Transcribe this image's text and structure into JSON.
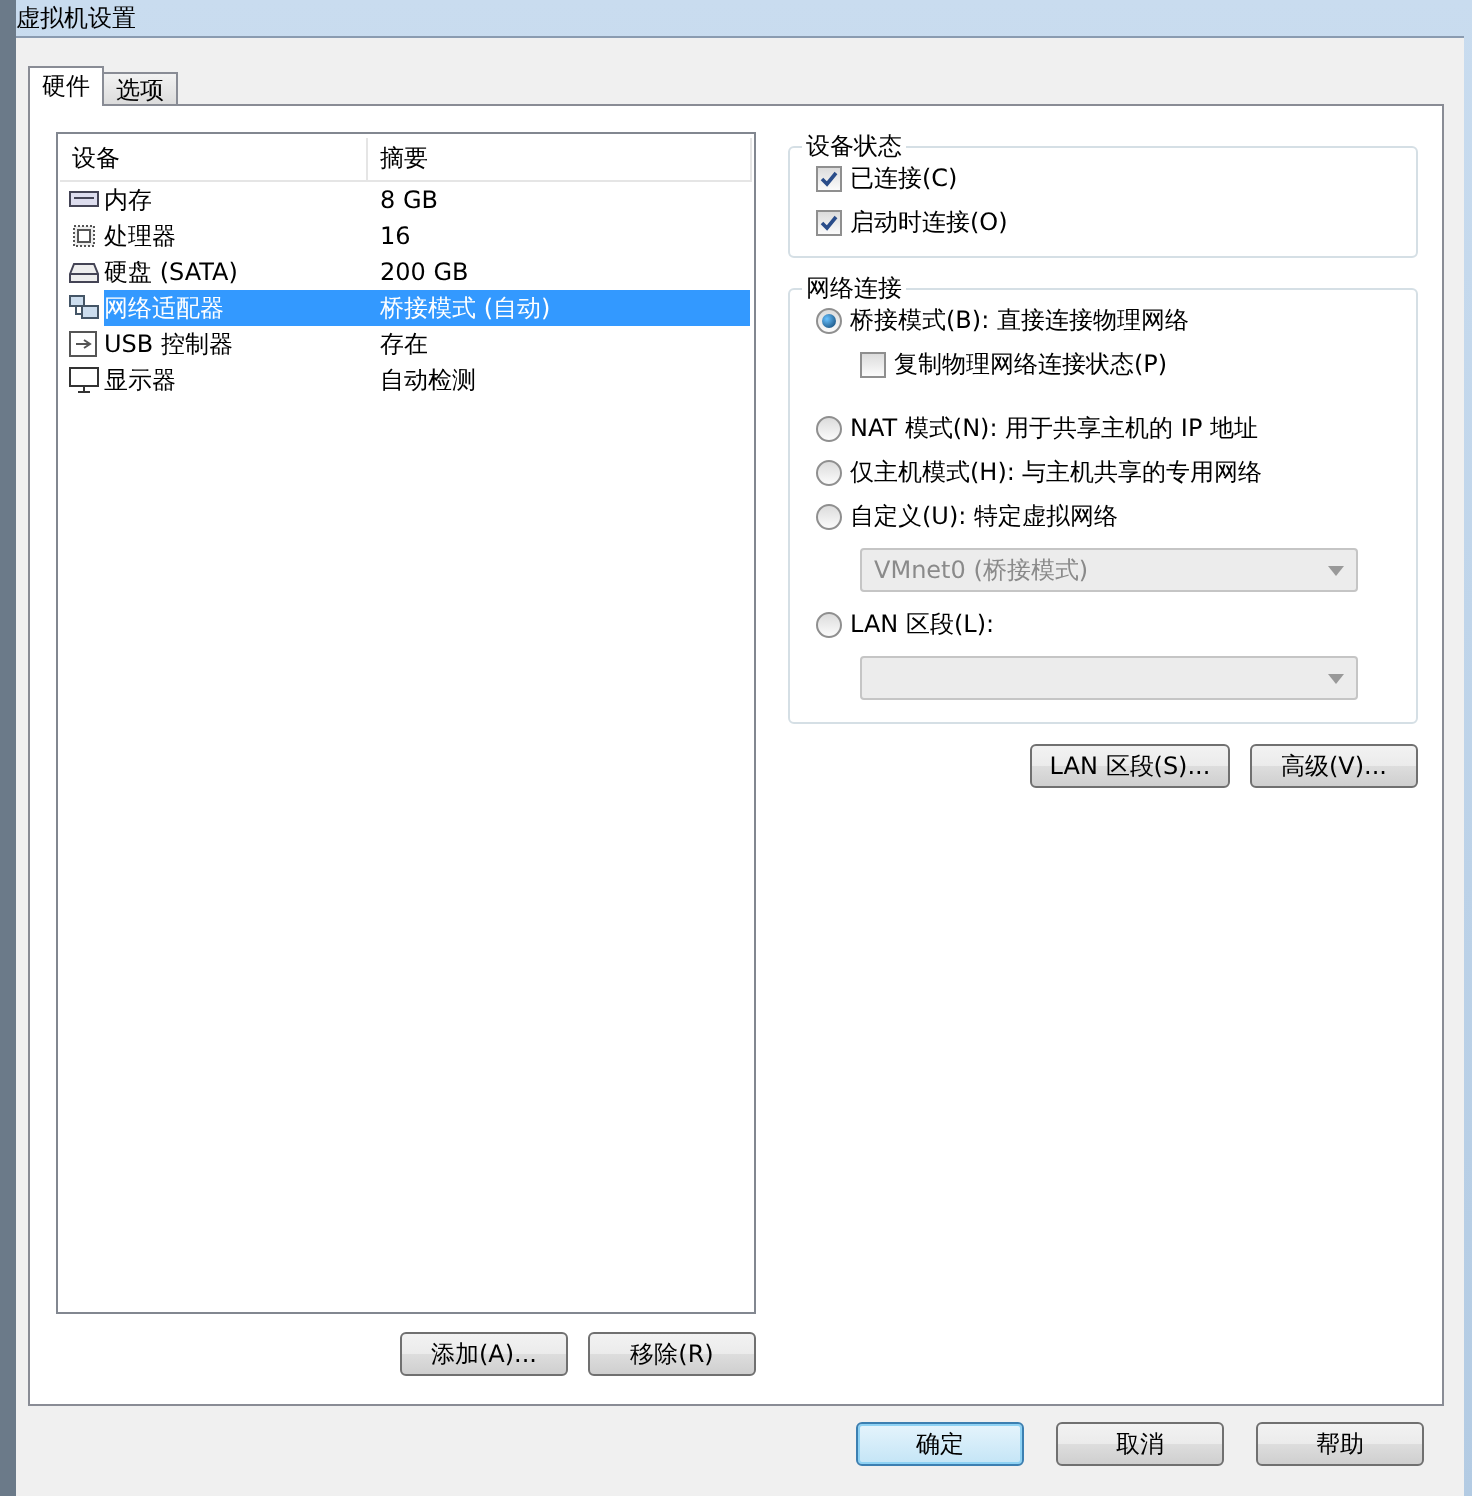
{
  "window": {
    "title": "虚拟机设置"
  },
  "tabs": [
    {
      "label": "硬件",
      "selected": true
    },
    {
      "label": "选项",
      "selected": false
    }
  ],
  "device_table": {
    "columns": [
      "设备",
      "摘要"
    ],
    "rows": [
      {
        "kind": "memory",
        "device": "内存",
        "summary": "8 GB",
        "selected": false
      },
      {
        "kind": "cpu",
        "device": "处理器",
        "summary": "16",
        "selected": false
      },
      {
        "kind": "disk",
        "device": "硬盘 (SATA)",
        "summary": "200 GB",
        "selected": false
      },
      {
        "kind": "network",
        "device": "网络适配器",
        "summary": "桥接模式 (自动)",
        "selected": true
      },
      {
        "kind": "usb",
        "device": "USB 控制器",
        "summary": "存在",
        "selected": false
      },
      {
        "kind": "display",
        "device": "显示器",
        "summary": "自动检测",
        "selected": false
      }
    ]
  },
  "list_buttons": [
    "添加(A)...",
    "移除(R)"
  ],
  "device_status": {
    "title": "设备状态",
    "options": [
      {
        "label": "已连接(C)",
        "checked": true
      },
      {
        "label": "启动时连接(O)",
        "checked": true
      }
    ]
  },
  "network_connection": {
    "title": "网络连接",
    "options": [
      {
        "label": "桥接模式(B): 直接连接物理网络",
        "selected": true,
        "sub_checkbox": {
          "label": "复制物理网络连接状态(P)",
          "checked": false
        }
      },
      {
        "label": "NAT 模式(N): 用于共享主机的 IP 地址",
        "selected": false
      },
      {
        "label": "仅主机模式(H): 与主机共享的专用网络",
        "selected": false
      },
      {
        "label": "自定义(U): 特定虚拟网络",
        "selected": false,
        "dropdown": {
          "value": "VMnet0 (桥接模式)",
          "disabled": true
        }
      },
      {
        "label": "LAN 区段(L):",
        "selected": false,
        "dropdown": {
          "disabled": true
        }
      }
    ]
  },
  "network_buttons": [
    "LAN 区段(S)...",
    "高级(V)..."
  ],
  "dialog_buttons": [
    {
      "label": "确定",
      "default": true
    },
    {
      "label": "取消",
      "default": false
    },
    {
      "label": "帮助",
      "default": false
    }
  ]
}
